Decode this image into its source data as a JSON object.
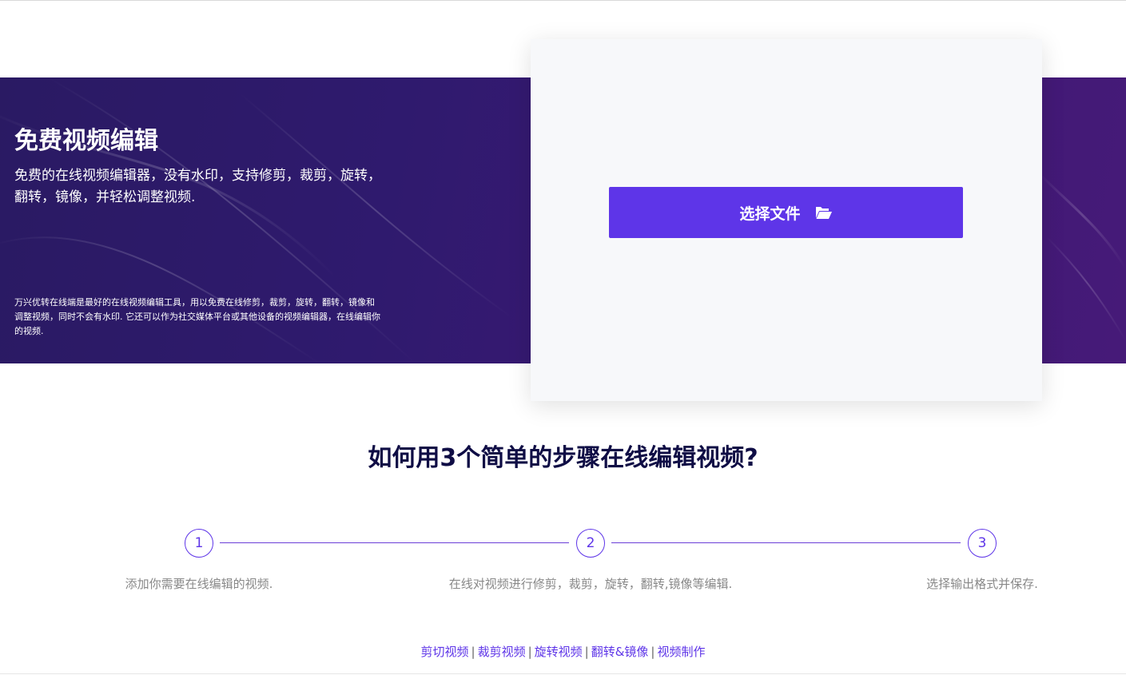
{
  "hero": {
    "title": "免费视频编辑",
    "subtitle": "免费的在线视频编辑器，没有水印，支持修剪，裁剪，旋转，翻转，镜像，并轻松调整视频.",
    "description": "万兴优转在线端是最好的在线视频编辑工具，用以免费在线修剪，裁剪，旋转，翻转，镜像和调整视频，同时不会有水印. 它还可以作为社交媒体平台或其他设备的视频编辑器，在线编辑你的视频."
  },
  "upload": {
    "button_label": "选择文件",
    "button_icon": "folder-open-icon"
  },
  "steps": {
    "heading": "如何用3个简单的步骤在线编辑视频?",
    "items": [
      {
        "number": "1",
        "text": "添加你需要在线编辑的视频."
      },
      {
        "number": "2",
        "text": "在线对视频进行修剪，裁剪，旋转，翻转,镜像等编辑."
      },
      {
        "number": "3",
        "text": "选择输出格式并保存."
      }
    ]
  },
  "footer": {
    "links": [
      "剪切视频",
      "裁剪视频",
      "旋转视频",
      "翻转&镜像",
      "视频制作"
    ],
    "separator": "|"
  },
  "colors": {
    "accent": "#5e35e8",
    "hero_bg": "#2f1a6e",
    "heading": "#0f0d45",
    "muted_text": "#888888"
  }
}
